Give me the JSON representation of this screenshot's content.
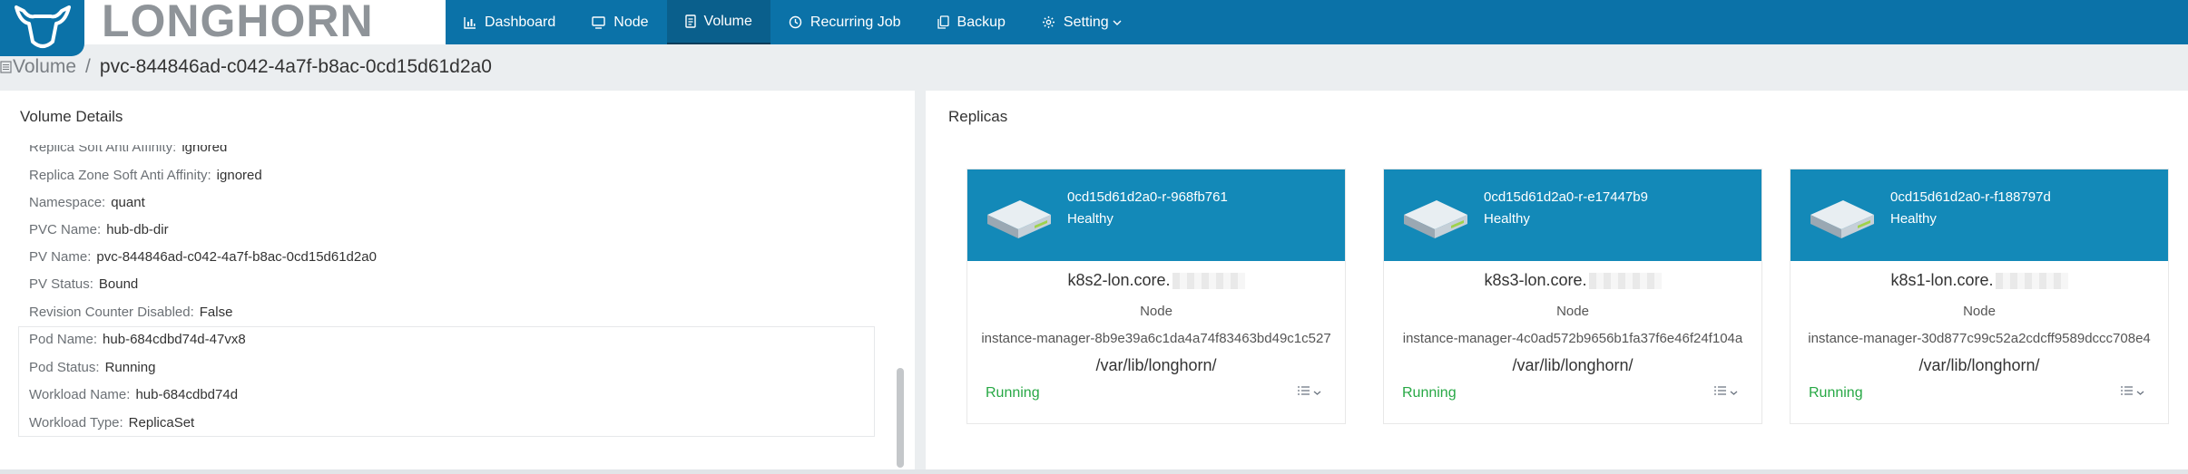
{
  "brand": {
    "name": "LONGHORN"
  },
  "nav": [
    {
      "label": "Dashboard",
      "icon": "bar-chart-icon"
    },
    {
      "label": "Node",
      "icon": "monitor-icon"
    },
    {
      "label": "Volume",
      "icon": "document-icon",
      "active": true
    },
    {
      "label": "Recurring Job",
      "icon": "clock-icon"
    },
    {
      "label": "Backup",
      "icon": "copy-icon"
    },
    {
      "label": "Setting",
      "icon": "gear-icon",
      "has_dropdown": true
    }
  ],
  "breadcrumb": {
    "root": "Volume",
    "separator": "/",
    "current": "pvc-844846ad-c042-4a7f-b8ac-0cd15d61d2a0"
  },
  "details": {
    "title": "Volume Details",
    "rows": [
      {
        "label": "Replica Soft Anti Affinity:",
        "value": "ignored"
      },
      {
        "label": "Replica Zone Soft Anti Affinity:",
        "value": "ignored"
      },
      {
        "label": "Namespace:",
        "value": "quant"
      },
      {
        "label": "PVC Name:",
        "value": "hub-db-dir"
      },
      {
        "label": "PV Name:",
        "value": "pvc-844846ad-c042-4a7f-b8ac-0cd15d61d2a0"
      },
      {
        "label": "PV Status:",
        "value": "Bound"
      },
      {
        "label": "Revision Counter Disabled:",
        "value": "False"
      },
      {
        "label": "Pod Name:",
        "value": "hub-684cdbd74d-47vx8"
      },
      {
        "label": "Pod Status:",
        "value": "Running"
      },
      {
        "label": "Workload Name:",
        "value": "hub-684cdbd74d"
      },
      {
        "label": "Workload Type:",
        "value": "ReplicaSet"
      }
    ]
  },
  "replicas": {
    "title": "Replicas",
    "node_label": "Node",
    "items": [
      {
        "name": "0cd15d61d2a0-r-968fb761",
        "health": "Healthy",
        "host": "k8s2-lon.core.",
        "instance_manager": "instance-manager-8b9e39a6c1da4a74f83463bd49c1c527",
        "path": "/var/lib/longhorn/",
        "status": "Running"
      },
      {
        "name": "0cd15d61d2a0-r-e17447b9",
        "health": "Healthy",
        "host": "k8s3-lon.core.",
        "instance_manager": "instance-manager-4c0ad572b9656b1fa37f6e46f24f104a",
        "path": "/var/lib/longhorn/",
        "status": "Running"
      },
      {
        "name": "0cd15d61d2a0-r-f188797d",
        "health": "Healthy",
        "host": "k8s1-lon.core.",
        "instance_manager": "instance-manager-30d877c99c52a2cdcff9589dccc708e4",
        "path": "/var/lib/longhorn/",
        "status": "Running"
      }
    ]
  },
  "colors": {
    "nav_bg": "#0b72a8",
    "card_head": "#1389b8",
    "running": "#27a845"
  }
}
